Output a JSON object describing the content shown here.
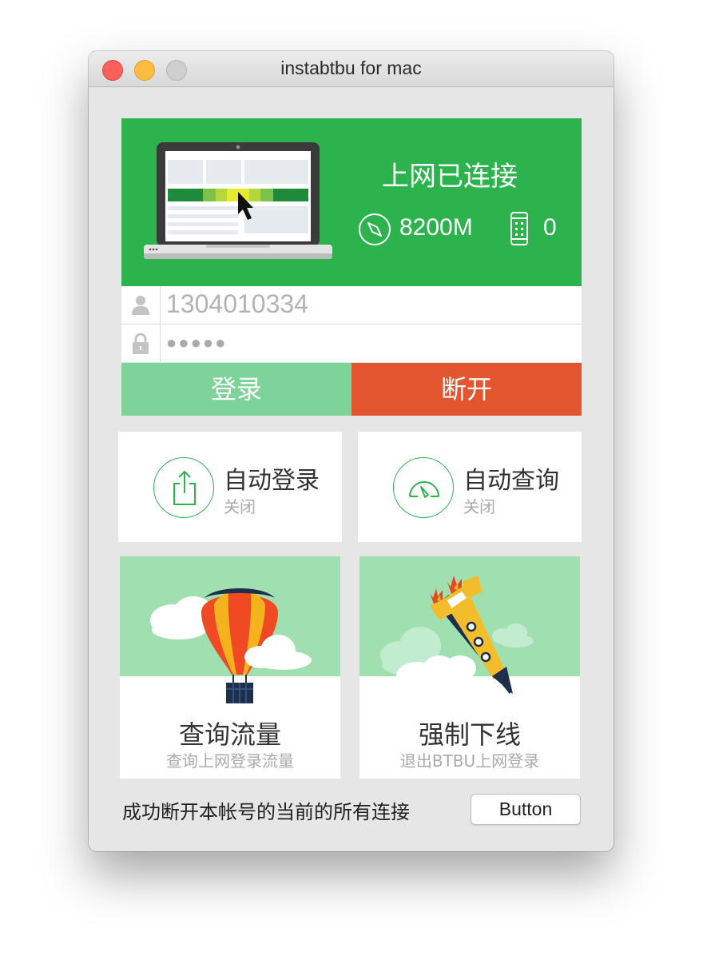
{
  "window": {
    "title": "instabtbu for mac"
  },
  "banner": {
    "status": "上网已连接",
    "traffic": "8200M",
    "devices": "0"
  },
  "login": {
    "account": "1304010334",
    "password_mask": "●●●●●",
    "login_label": "登录",
    "disconnect_label": "断开"
  },
  "cards": [
    {
      "title": "自动登录",
      "subtitle": "关闭",
      "icon": "share-upload-icon"
    },
    {
      "title": "自动查询",
      "subtitle": "关闭",
      "icon": "speedometer-icon"
    }
  ],
  "tiles": [
    {
      "title": "查询流量",
      "subtitle": "查询上网登录流量",
      "icon": "hot-air-balloon-icon"
    },
    {
      "title": "强制下线",
      "subtitle": "退出BTBU上网登录",
      "icon": "rocket-icon"
    }
  ],
  "footer": {
    "message": "成功断开本帐号的当前的所有连接",
    "button_label": "Button"
  },
  "colors": {
    "green": "#2db34e",
    "light_green": "#7ed39b",
    "red": "#e2552f",
    "sky": "#a0e0b0"
  }
}
